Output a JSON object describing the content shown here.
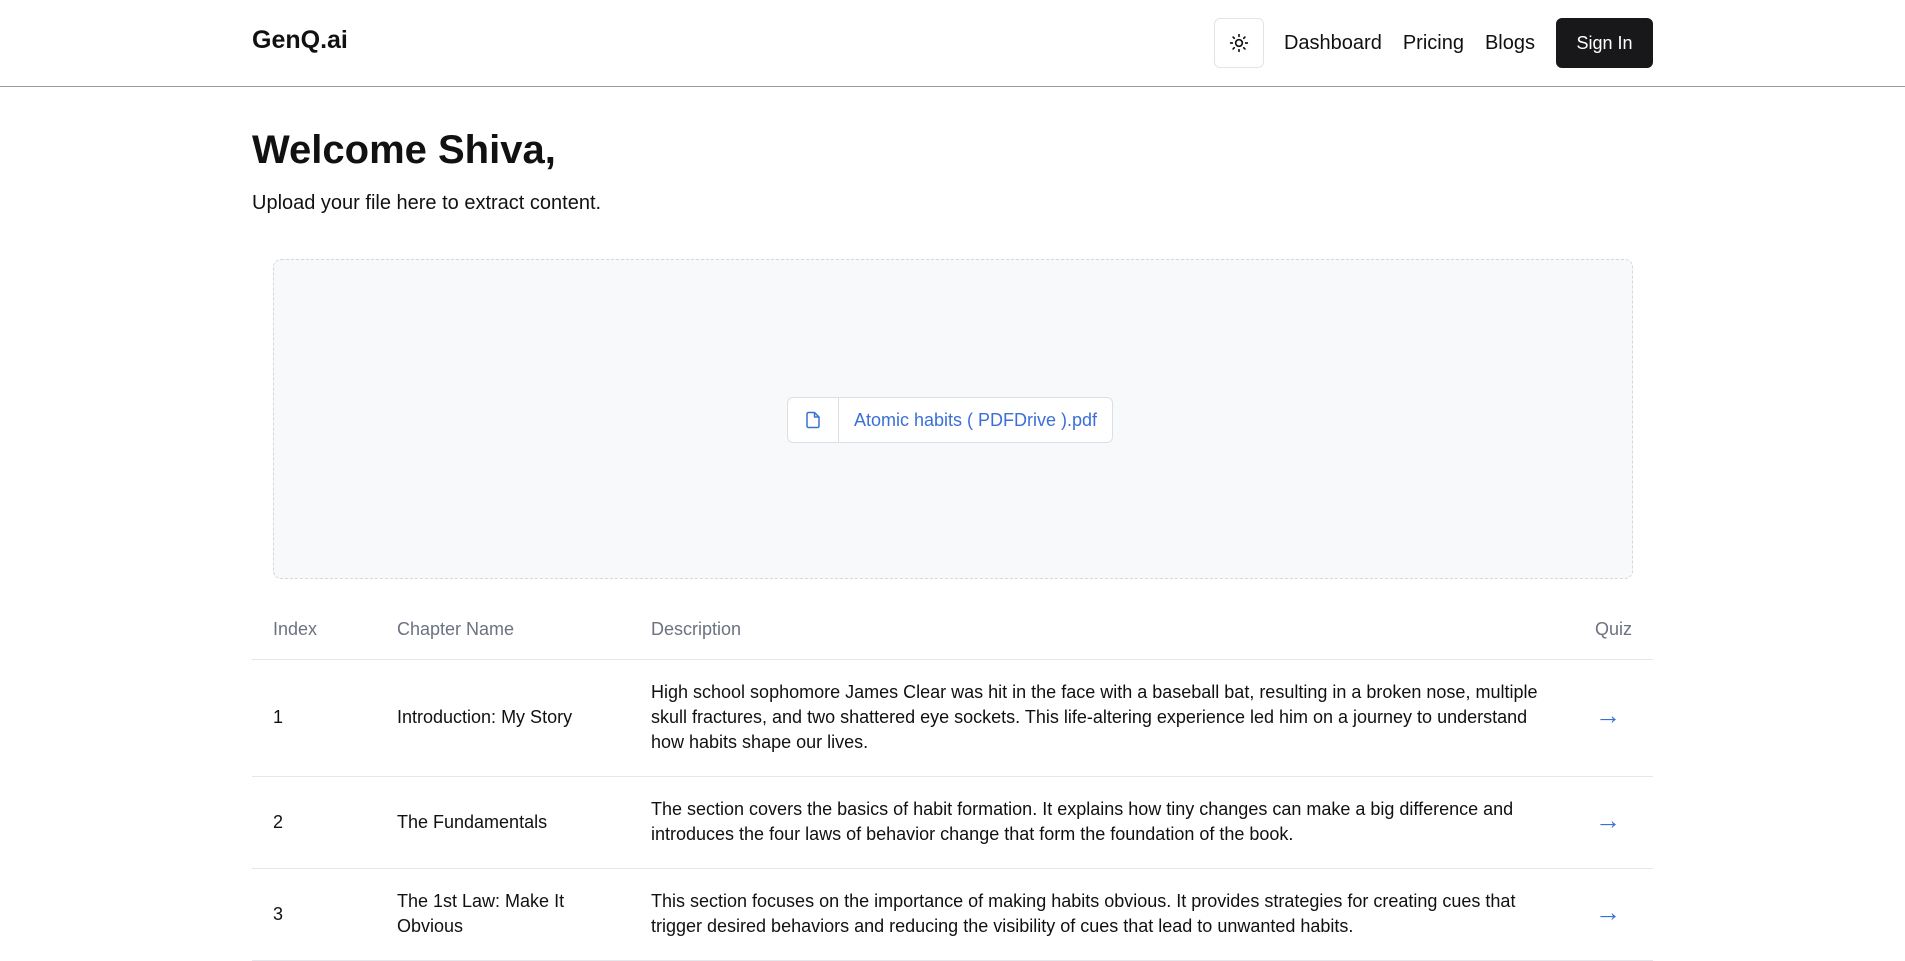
{
  "header": {
    "logo": "GenQ.ai",
    "theme_toggle_icon": "sun-icon",
    "nav": [
      "Dashboard",
      "Pricing",
      "Blogs"
    ],
    "signin_label": "Sign In"
  },
  "main": {
    "welcome": "Welcome Shiva,",
    "subtitle": "Upload your file here to extract content.",
    "file": {
      "icon": "file-icon",
      "name": "Atomic habits ( PDFDrive ).pdf"
    }
  },
  "table": {
    "headers": [
      "Index",
      "Chapter Name",
      "Description",
      "Quiz"
    ],
    "rows": [
      {
        "index": "1",
        "chapter": "Introduction: My Story",
        "description": "High school sophomore James Clear was hit in the face with a baseball bat, resulting in a broken nose, multiple skull fractures, and two shattered eye sockets. This life-altering experience led him on a journey to understand how habits shape our lives.",
        "quiz": "→"
      },
      {
        "index": "2",
        "chapter": "The Fundamentals",
        "description": "The section covers the basics of habit formation. It explains how tiny changes can make a big difference and introduces the four laws of behavior change that form the foundation of the book.",
        "quiz": "→"
      },
      {
        "index": "3",
        "chapter": "The 1st Law: Make It Obvious",
        "description": "This section focuses on the importance of making habits obvious. It provides strategies for creating cues that trigger desired behaviors and reducing the visibility of cues that lead to unwanted habits.",
        "quiz": "→"
      }
    ]
  },
  "colors": {
    "accent": "#3b6fd6",
    "primary_button": "#18181b",
    "muted_text": "#6b7280"
  }
}
